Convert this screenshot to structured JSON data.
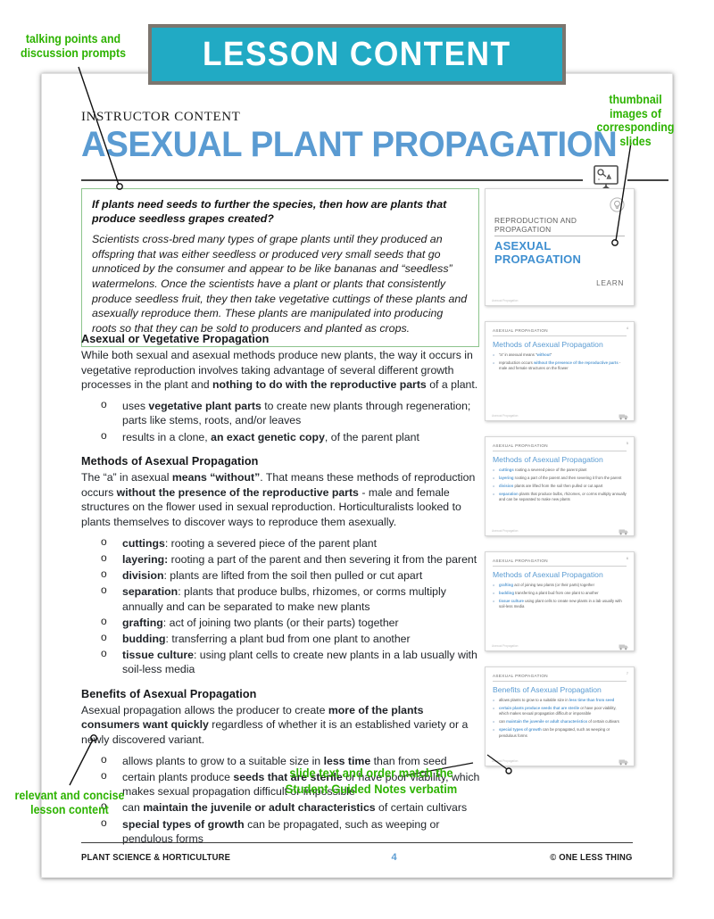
{
  "banner": {
    "label": "LESSON CONTENT"
  },
  "annotations": {
    "top_left": "talking points and discussion prompts",
    "top_right": "thumbnail images of corresponding slides",
    "bottom_left": "relevant and concise lesson content",
    "slide_match": "slide text and order match the Student Guided Notes verbatim"
  },
  "document": {
    "kicker": "INSTRUCTOR CONTENT",
    "title": "ASEXUAL PLANT PROPAGATION",
    "easel_icon": "presentation-easel-icon"
  },
  "question_box": {
    "question": "If plants need seeds to further the species, then how are plants that produce seedless grapes created?",
    "answer": "Scientists cross-bred many types of grape plants until they produced an offspring that was either seedless or produced very small seeds that go unnoticed by the consumer and appear to be like bananas and “seedless” watermelons. Once the scientists have a plant or plants that consistently produce seedless fruit, they then take vegetative cuttings of these plants and asexually reproduce them. These plants are manipulated into producing roots so that they can be sold to producers and planted as crops."
  },
  "sections": [
    {
      "heading": "Asexual or Vegetative Propagation",
      "paragraph_html": "While both sexual and asexual methods produce new plants, the way it occurs in vegetative reproduction involves taking advantage of several different growth processes in the plant and <b>nothing to do with the reproductive parts</b> of a plant.",
      "bullets_html": [
        "uses <b>vegetative plant parts</b> to create new plants through regeneration; parts like stems, roots, and/or leaves",
        "results in a clone, <b>an exact genetic copy</b>, of the parent plant"
      ]
    },
    {
      "heading": "Methods of Asexual Propagation",
      "paragraph_html": "The “a” in asexual <b>means “without”</b>. That means these methods of reproduction occurs <b>without the presence of the reproductive parts</b> - male and female structures on the flower used in sexual reproduction. Horticulturalists looked to plants themselves to discover ways to reproduce them asexually.",
      "bullets_html": [
        "<b>cuttings</b>: rooting a severed piece of the parent plant",
        "<b>layering:</b> rooting a part of the parent and then severing it from the parent",
        "<b>division</b>: plants are lifted from the soil then pulled or cut apart",
        "<b>separation</b>: plants that produce bulbs, rhizomes, or corms multiply annually and can be separated to make new plants",
        "<b>grafting</b>: act of joining two plants (or their parts) together",
        "<b>budding</b>: transferring a plant bud from one plant to another",
        "<b>tissue culture</b>: using plant cells to create new plants in a lab usually with soil-less media"
      ]
    },
    {
      "heading": "Benefits of Asexual Propagation",
      "paragraph_html": "Asexual propagation allows the producer to create <b>more of the plants consumers want quickly</b> regardless of whether it is an established variety or a newly discovered variant.",
      "bullets_html": [
        "allows plants to grow to a suitable size in <b>less time</b> than from seed",
        "certain plants produce <b>seeds that are sterile</b> or have poor viability, which makes sexual propagation difficult or impossible",
        "can <b>maintain the juvenile or adult characteristics</b> of certain cultivars",
        "<b>special types of growth</b> can be propagated, such as weeping or pendulous forms"
      ]
    }
  ],
  "thumbnails": [
    {
      "type": "title",
      "eyebrow": "REPRODUCTION AND PROPAGATION",
      "title": "ASEXUAL PROPAGATION",
      "action": "LEARN",
      "footer": "Asexual Propagation",
      "icon": "lightbulb-badge-icon"
    },
    {
      "type": "bullets",
      "eyebrow": "ASEXUAL PROPAGATION",
      "heading": "Methods of Asexual Propagation",
      "number": "4",
      "footer": "Asexual Propagation",
      "bullets_html": [
        "“a” in asexual means “<b>without</b>”",
        "reproduction occurs <b>without the presence of the reproductive parts</b> - male and female structures on the flower"
      ]
    },
    {
      "type": "bullets",
      "eyebrow": "ASEXUAL PROPAGATION",
      "heading": "Methods of Asexual Propagation",
      "number": "5",
      "footer": "Asexual Propagation",
      "bullets_html": [
        "<b>cuttings</b> rooting a severed piece of the parent plant",
        "<b>layering</b> rooting a part of the parent and then severing it from the parent",
        "<b>division</b> plants are lifted from the soil then pulled or cut apart",
        "<b>separation</b> plants that produce bulbs, rhizomes, or corms multiply annually and can be separated to make new plants"
      ]
    },
    {
      "type": "bullets",
      "eyebrow": "ASEXUAL PROPAGATION",
      "heading": "Methods of Asexual Propagation",
      "number": "6",
      "footer": "Asexual Propagation",
      "bullets_html": [
        "<b>grafting</b> act of joining two plants (or their parts) together",
        "<b>budding</b> transferring a plant bud from one plant to another",
        "<b>tissue culture</b> using plant cells to create new plants in a lab usually with soil-less media"
      ]
    },
    {
      "type": "bullets",
      "eyebrow": "ASEXUAL PROPAGATION",
      "heading": "Benefits of Asexual Propagation",
      "number": "7",
      "footer": "Asexual Propagation",
      "bullets_html": [
        "allows plants to grow to a suitable size in <b>less time than from seed</b>",
        "<b>certain plants produce seeds that are sterile</b> or have poor viability, which makes sexual propagation difficult or impossible",
        "can <b>maintain the juvenile or adult characteristics</b> of certain cultivars",
        "<b>special types of growth</b> can be propagated, such as weeping or pendulous forms"
      ]
    }
  ],
  "footer": {
    "left": "PLANT SCIENCE & HORTICULTURE",
    "page": "4",
    "right": "© ONE LESS THING"
  },
  "colors": {
    "banner_teal": "#21aac4",
    "banner_border": "#7c756e",
    "title_blue": "#5a9bd2",
    "annotation_green": "#2db300",
    "question_box_border": "#8dc48d"
  }
}
